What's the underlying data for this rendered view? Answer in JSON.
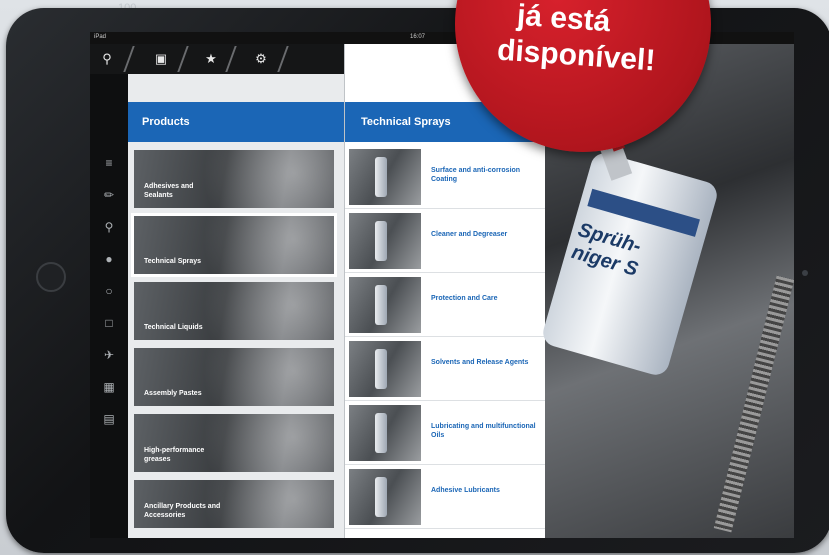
{
  "statusbar": {
    "device": "iPad",
    "time": "16:07"
  },
  "badge": {
    "line1": "já está",
    "line2": "disponível!"
  },
  "toolbar": {
    "icons": [
      "search-icon",
      "gallery-icon",
      "star-icon",
      "gear-icon"
    ]
  },
  "sidebar": {
    "icons": [
      "sprays-icon",
      "spray-gun-icon",
      "search-icon",
      "car-icon",
      "bulb-icon",
      "toolbox-icon",
      "plane-icon",
      "grid-icon",
      "building-icon"
    ]
  },
  "products": {
    "header": "Products",
    "items": [
      {
        "label": "Adhesives and Sealants"
      },
      {
        "label": "Technical Sprays"
      },
      {
        "label": "Technical Liquids"
      },
      {
        "label": "Assembly Pastes"
      },
      {
        "label": "High-performance greases"
      },
      {
        "label": "Ancillary Products and Accessories"
      }
    ]
  },
  "technical_sprays": {
    "header": "Technical Sprays",
    "items": [
      {
        "label": "Surface and anti-corrosion Coating"
      },
      {
        "label": "Cleaner and Degreaser"
      },
      {
        "label": "Protection and Care"
      },
      {
        "label": "Solvents and Release Agents"
      },
      {
        "label": "Lubricating and multifunctional Oils"
      },
      {
        "label": "Adhesive Lubricants"
      }
    ]
  },
  "photo": {
    "can_text": "Sprüh-\nniger S"
  },
  "colors": {
    "accent": "#1b66b6",
    "badge": "#c51e24"
  }
}
